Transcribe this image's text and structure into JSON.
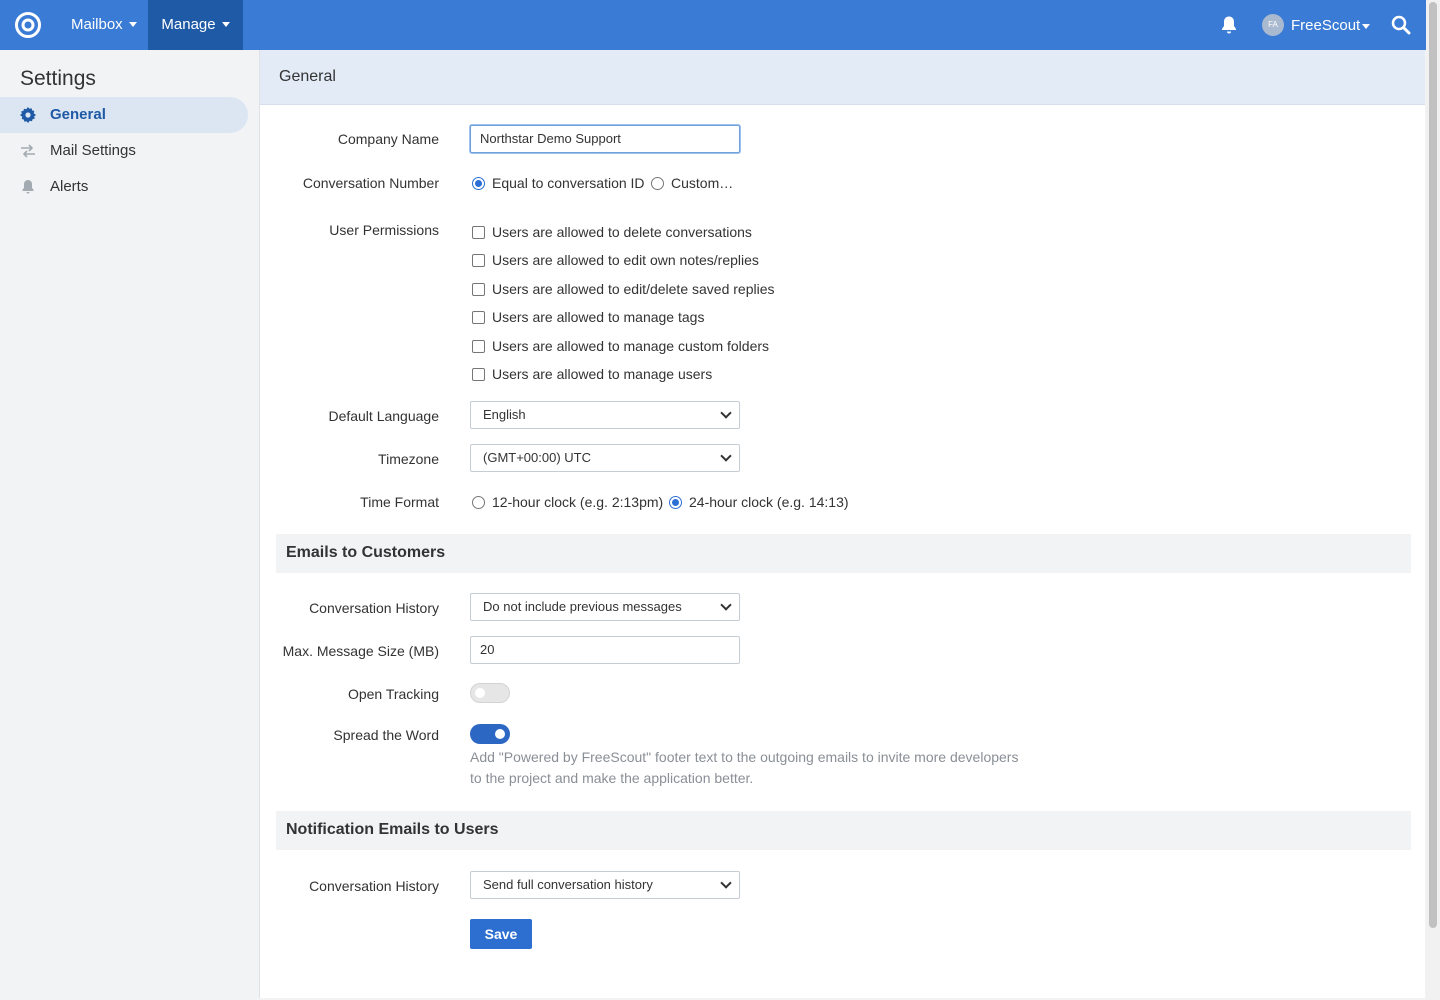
{
  "nav": {
    "mailbox_label": "Mailbox",
    "manage_label": "Manage",
    "user_initials": "FA",
    "user_name": "FreeScout",
    "accent_color": "#3a7bd5",
    "active_color": "#1f5aa6"
  },
  "sidebar": {
    "title": "Settings",
    "items": [
      {
        "label": "General",
        "icon": "gear-icon",
        "active": true
      },
      {
        "label": "Mail Settings",
        "icon": "arrows-icon",
        "active": false
      },
      {
        "label": "Alerts",
        "icon": "bell-icon",
        "active": false
      }
    ]
  },
  "main": {
    "title": "General",
    "company_name": {
      "label": "Company Name",
      "value": "Northstar Demo Support"
    },
    "conversation_number": {
      "label": "Conversation Number",
      "options": [
        "Equal to conversation ID",
        "Custom…"
      ],
      "selected": "Equal to conversation ID"
    },
    "user_permissions": {
      "label": "User Permissions",
      "options": [
        "Users are allowed to delete conversations",
        "Users are allowed to edit own notes/replies",
        "Users are allowed to edit/delete saved replies",
        "Users are allowed to manage tags",
        "Users are allowed to manage custom folders",
        "Users are allowed to manage users"
      ]
    },
    "default_language": {
      "label": "Default Language",
      "value": "English"
    },
    "timezone": {
      "label": "Timezone",
      "value": "(GMT+00:00) UTC"
    },
    "time_format": {
      "label": "Time Format",
      "options": [
        "12-hour clock (e.g. 2:13pm)",
        "24-hour clock (e.g. 14:13)"
      ],
      "selected": "24-hour clock (e.g. 14:13)"
    },
    "emails_to_customers": {
      "title": "Emails to Customers",
      "conversation_history": {
        "label": "Conversation History",
        "value": "Do not include previous messages"
      },
      "max_message_size": {
        "label": "Max. Message Size (MB)",
        "value": "20"
      },
      "open_tracking": {
        "label": "Open Tracking",
        "enabled": false
      },
      "spread_the_word": {
        "label": "Spread the Word",
        "enabled": true,
        "help": "Add \"Powered by FreeScout\" footer text to the outgoing emails to invite more developers to the project and make the application better."
      }
    },
    "notification_emails": {
      "title": "Notification Emails to Users",
      "conversation_history": {
        "label": "Conversation History",
        "value": "Send full conversation history"
      }
    },
    "save_label": "Save"
  }
}
